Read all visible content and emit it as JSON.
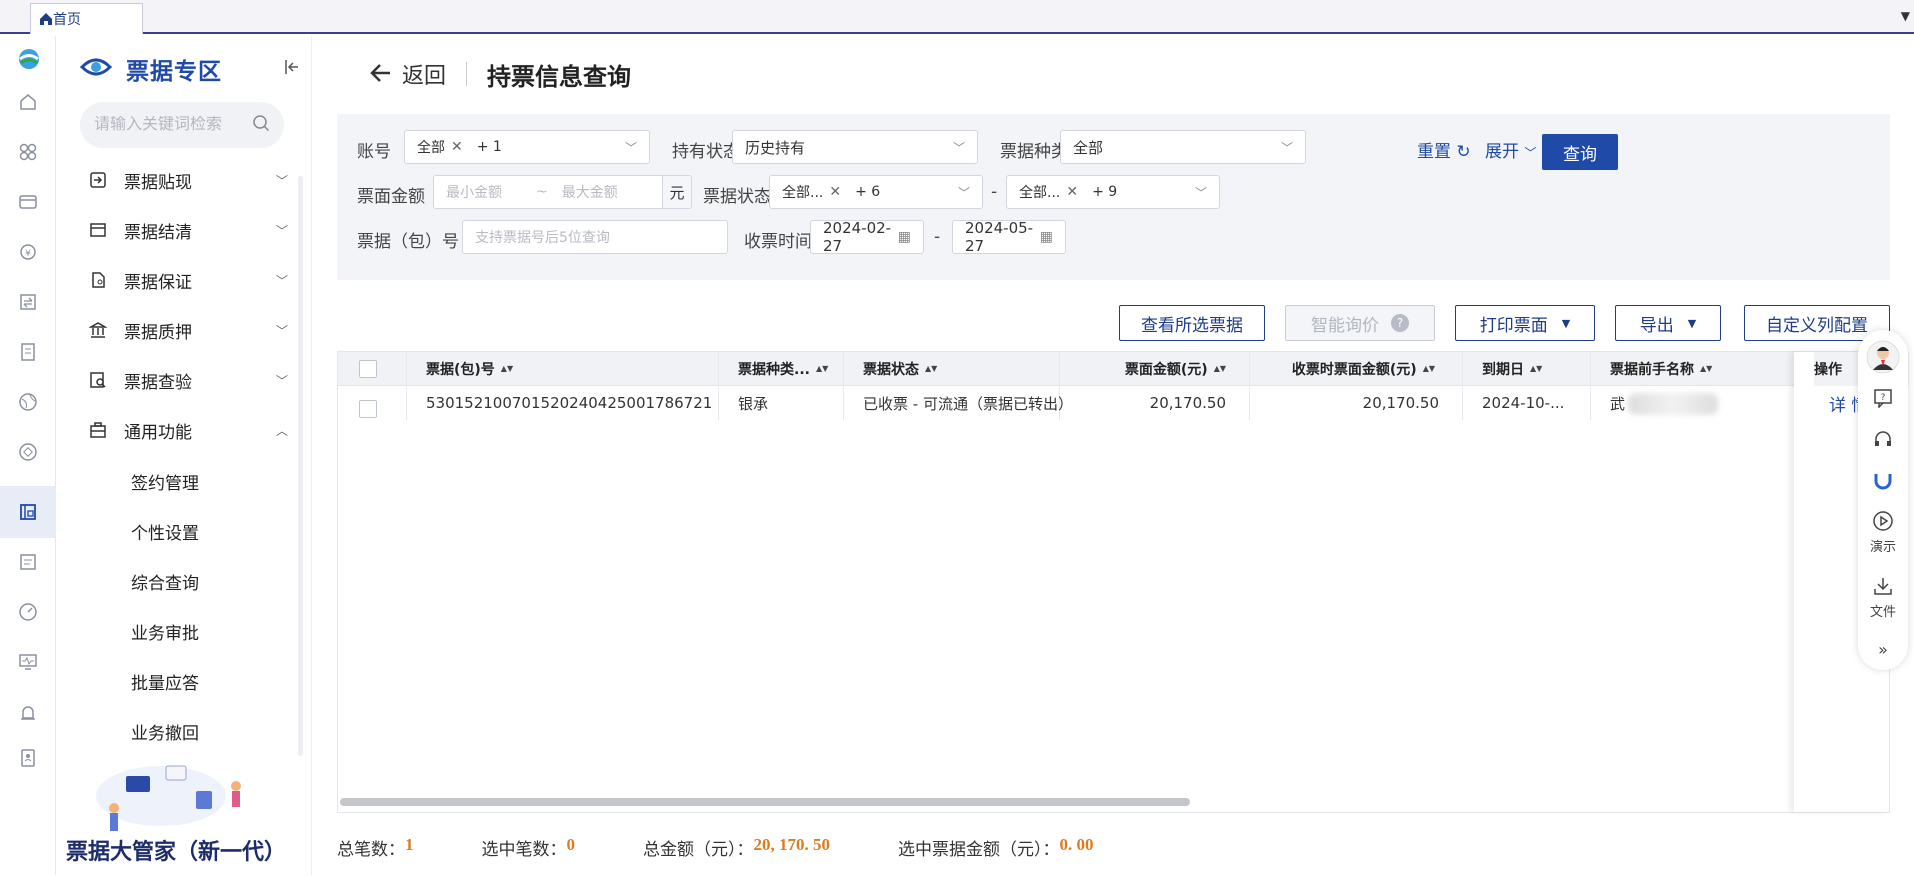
{
  "tabbar": {
    "home_tab": "首页"
  },
  "sidebar": {
    "brand": "票据专区",
    "search_placeholder": "请输入关键词检索",
    "menu": [
      {
        "label": "票据贴现",
        "icon": "discount-icon"
      },
      {
        "label": "票据结清",
        "icon": "card-icon"
      },
      {
        "label": "票据保证",
        "icon": "document-icon"
      },
      {
        "label": "票据质押",
        "icon": "bank-icon"
      },
      {
        "label": "票据查验",
        "icon": "inspect-icon"
      },
      {
        "label": "通用功能",
        "icon": "briefcase-icon"
      }
    ],
    "submenu": [
      "签约管理",
      "个性设置",
      "综合查询",
      "业务审批",
      "批量应答",
      "业务撤回"
    ],
    "promo_text": "票据大管家（新一代）"
  },
  "header": {
    "back": "返回",
    "title": "持票信息查询"
  },
  "filter": {
    "account_label": "账号",
    "account_chip": "全部",
    "account_more": "+ 1",
    "hold_label": "持有状态",
    "hold_value": "历史持有",
    "type_label": "票据种类",
    "type_value": "全部",
    "amount_label": "票面金额",
    "amount_min_ph": "最小金额",
    "amount_sep": "~",
    "amount_max_ph": "最大金额",
    "amount_unit": "元",
    "status_label": "票据状态",
    "status_chip1": "全部...",
    "status_more1": "+ 6",
    "status_dash": "-",
    "status_chip2": "全部...",
    "status_more2": "+ 9",
    "no_label": "票据（包）号",
    "no_ph": "支持票据号后5位查询",
    "date_label": "收票时间",
    "date_from": "2024-02-27",
    "date_dash": "-",
    "date_to": "2024-05-27",
    "reset": "重置",
    "expand": "展开",
    "query": "查询"
  },
  "actions": {
    "view_selected": "查看所选票据",
    "smart_inquiry": "智能询价",
    "print": "打印票面",
    "export": "导出",
    "custom_cols": "自定义列配置"
  },
  "table": {
    "headers": [
      "票据(包)号",
      "票据种类...",
      "票据状态",
      "票面金额(元)",
      "收票时票面金额(元)",
      "到期日",
      "票据前手名称",
      "操作"
    ],
    "rows": [
      {
        "no": "530152100701520240425001786721",
        "type": "银承",
        "status": "已收票 - 可流通（票据已转出）",
        "amount": "20,170.50",
        "recv_amount": "20,170.50",
        "due": "2024-10-...",
        "prev": "武",
        "op": "详 情"
      }
    ]
  },
  "footer": {
    "total_count_label": "总笔数：",
    "total_count": "1",
    "sel_count_label": "选中笔数：",
    "sel_count": "0",
    "total_amount_label": "总金额（元）：",
    "total_amount": "20, 170. 50",
    "sel_amount_label": "选中票据金额（元）：",
    "sel_amount": "0. 00"
  },
  "float": {
    "demo": "演示",
    "file": "文件"
  },
  "colors": {
    "brand": "#1f4aa8",
    "accent": "#e07a1c"
  }
}
